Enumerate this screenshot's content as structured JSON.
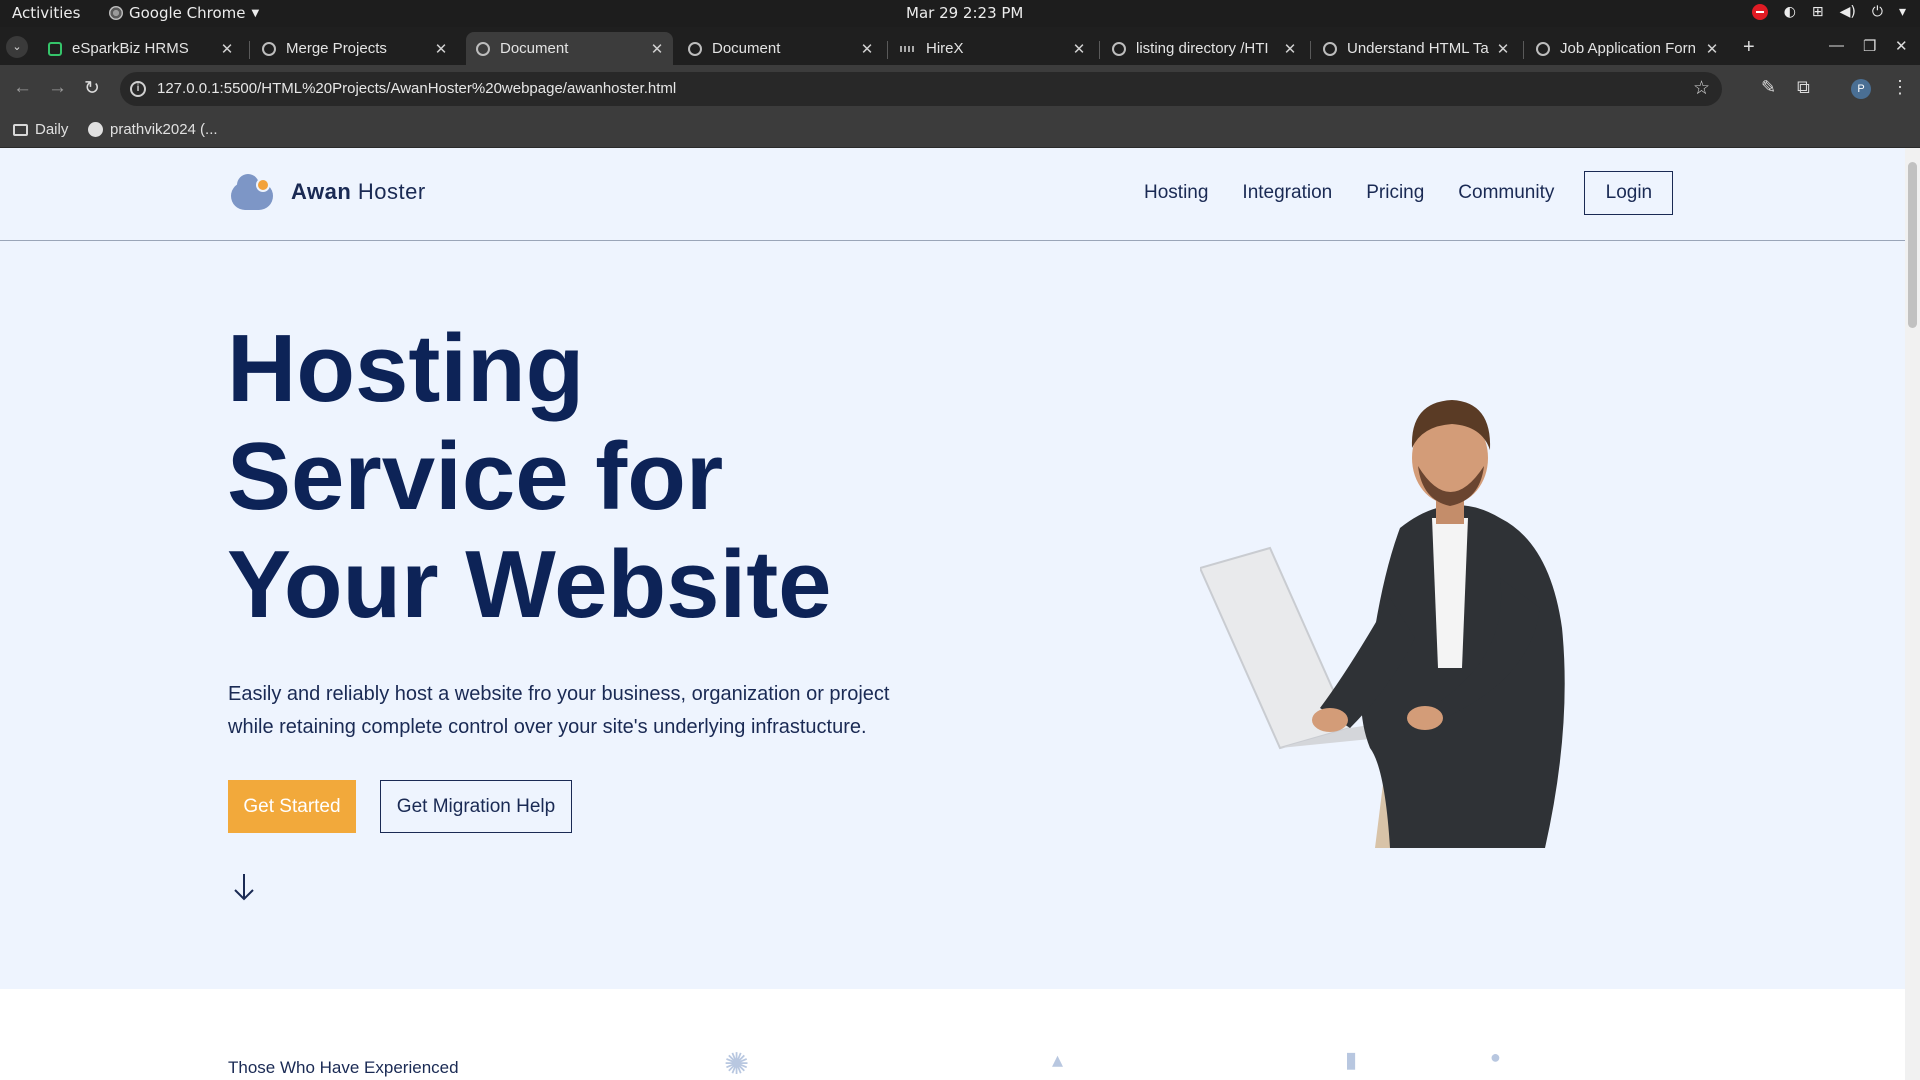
{
  "topbar": {
    "activities": "Activities",
    "app_name": "Google Chrome",
    "clock": "Mar 29  2:23 PM"
  },
  "tabs": [
    {
      "label": "eSparkBiz HRMS",
      "active": false
    },
    {
      "label": "Merge Projects",
      "active": false
    },
    {
      "label": "Document",
      "active": true
    },
    {
      "label": "Document",
      "active": false
    },
    {
      "label": "HireX",
      "active": false
    },
    {
      "label": "listing directory /HTI",
      "active": false
    },
    {
      "label": "Understand HTML Ta",
      "active": false
    },
    {
      "label": "Job Application Forn",
      "active": false
    }
  ],
  "toolbar": {
    "url": "127.0.0.1:5500/HTML%20Projects/AwanHoster%20webpage/awanhoster.html",
    "profile_initial": "P"
  },
  "bookmarks": [
    {
      "label": "Daily",
      "icon": "folder-icon"
    },
    {
      "label": "prathvik2024 (...",
      "icon": "github-icon"
    }
  ],
  "site": {
    "brand_bold": "Awan",
    "brand_light": " Hoster",
    "nav": [
      "Hosting",
      "Integration",
      "Pricing",
      "Community"
    ],
    "login": "Login",
    "headline": [
      "Hosting",
      "Service for",
      "Your Website"
    ],
    "subtext_line1": "Easily and reliably host a website fro your business, organization or project",
    "subtext_line2": "while retaining complete control over your site's underlying infrastucture.",
    "cta_primary": "Get Started",
    "cta_secondary": "Get Migration Help",
    "section2_caption": "Those Who Have Experienced"
  },
  "colors": {
    "hero_bg": "#eef4fe",
    "navy": "#0d2357",
    "accent_orange": "#f2a93b",
    "logo_cloud": "#7d96c6"
  }
}
